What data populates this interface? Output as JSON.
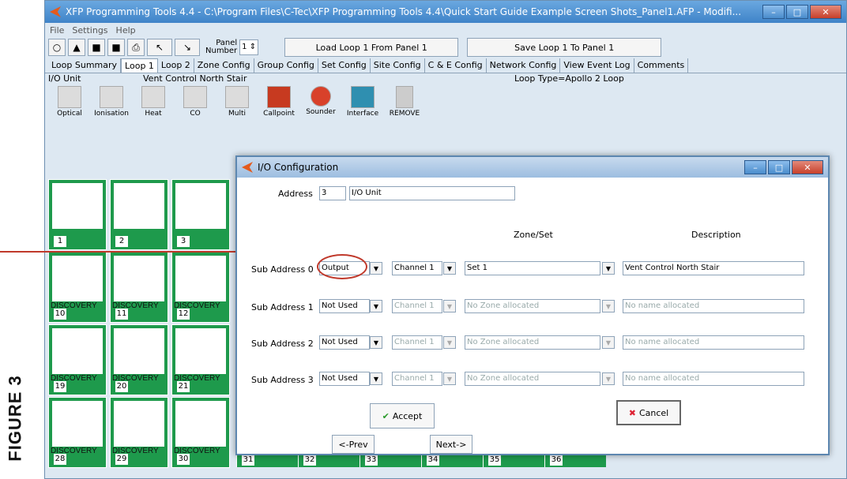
{
  "figure_label": "FIGURE 3",
  "window": {
    "title": "XFP Programming Tools 4.4 - C:\\Program Files\\C-Tec\\XFP Programming Tools 4.4\\Quick Start Guide Example Screen Shots_Panel1.AFP - Modifi..."
  },
  "menu": [
    "File",
    "Settings",
    "Help"
  ],
  "toolbar": {
    "panel_number_label_1": "Panel",
    "panel_number_label_2": "Number",
    "panel_number_value": "1",
    "load_button": "Load Loop 1 From Panel 1",
    "save_button": "Save Loop 1 To Panel 1"
  },
  "tabs": [
    "Loop Summary",
    "Loop 1",
    "Loop 2",
    "Zone Config",
    "Group Config",
    "Set Config",
    "Site Config",
    "C & E Config",
    "Network Config",
    "View Event Log",
    "Comments"
  ],
  "active_tab": "Loop 1",
  "info": {
    "unit_type": "I/O Unit",
    "unit_name": "Vent Control North Stair",
    "loop_type": "Loop Type=Apollo 2 Loop"
  },
  "palette": [
    "Optical",
    "Ionisation",
    "Heat",
    "CO",
    "Multi",
    "Callpoint",
    "Sounder",
    "Interface",
    "REMOVE"
  ],
  "devices": [
    {
      "label": "",
      "num": "1"
    },
    {
      "label": "",
      "num": "2"
    },
    {
      "label": "",
      "num": "3"
    },
    {
      "label": "DISCOVERY",
      "num": "10"
    },
    {
      "label": "DISCOVERY",
      "num": "11"
    },
    {
      "label": "DISCOVERY",
      "num": "12"
    },
    {
      "label": "DISCOVERY",
      "num": "19"
    },
    {
      "label": "DISCOVERY",
      "num": "20"
    },
    {
      "label": "DISCOVERY",
      "num": "21"
    },
    {
      "label": "DISCOVERY",
      "num": "28"
    },
    {
      "label": "DISCOVERY",
      "num": "29"
    },
    {
      "label": "DISCOVERY",
      "num": "30"
    }
  ],
  "bottom_numbers": [
    "31",
    "32",
    "33",
    "34",
    "35",
    "36"
  ],
  "dialog": {
    "title": "I/O Configuration",
    "address_label": "Address",
    "address_value": "3",
    "unit_value": "I/O Unit",
    "zone_header": "Zone/Set",
    "desc_header": "Description",
    "rows": [
      {
        "label": "Sub Address 0",
        "type": "Output",
        "channel": "Channel 1",
        "zone": "Set 1",
        "desc": "Vent Control North Stair"
      },
      {
        "label": "Sub Address 1",
        "type": "Not Used",
        "channel": "Channel 1",
        "zone": "No Zone allocated",
        "desc": "No name allocated"
      },
      {
        "label": "Sub Address 2",
        "type": "Not Used",
        "channel": "Channel 1",
        "zone": "No Zone allocated",
        "desc": "No name allocated"
      },
      {
        "label": "Sub Address 3",
        "type": "Not Used",
        "channel": "Channel 1",
        "zone": "No Zone allocated",
        "desc": "No name allocated"
      }
    ],
    "accept_label": "Accept",
    "cancel_label": "Cancel",
    "prev_label": "<-Prev",
    "next_label": "Next->"
  },
  "colors": {
    "device_green": "#1e9a4c",
    "callout_red": "#c0392b"
  }
}
